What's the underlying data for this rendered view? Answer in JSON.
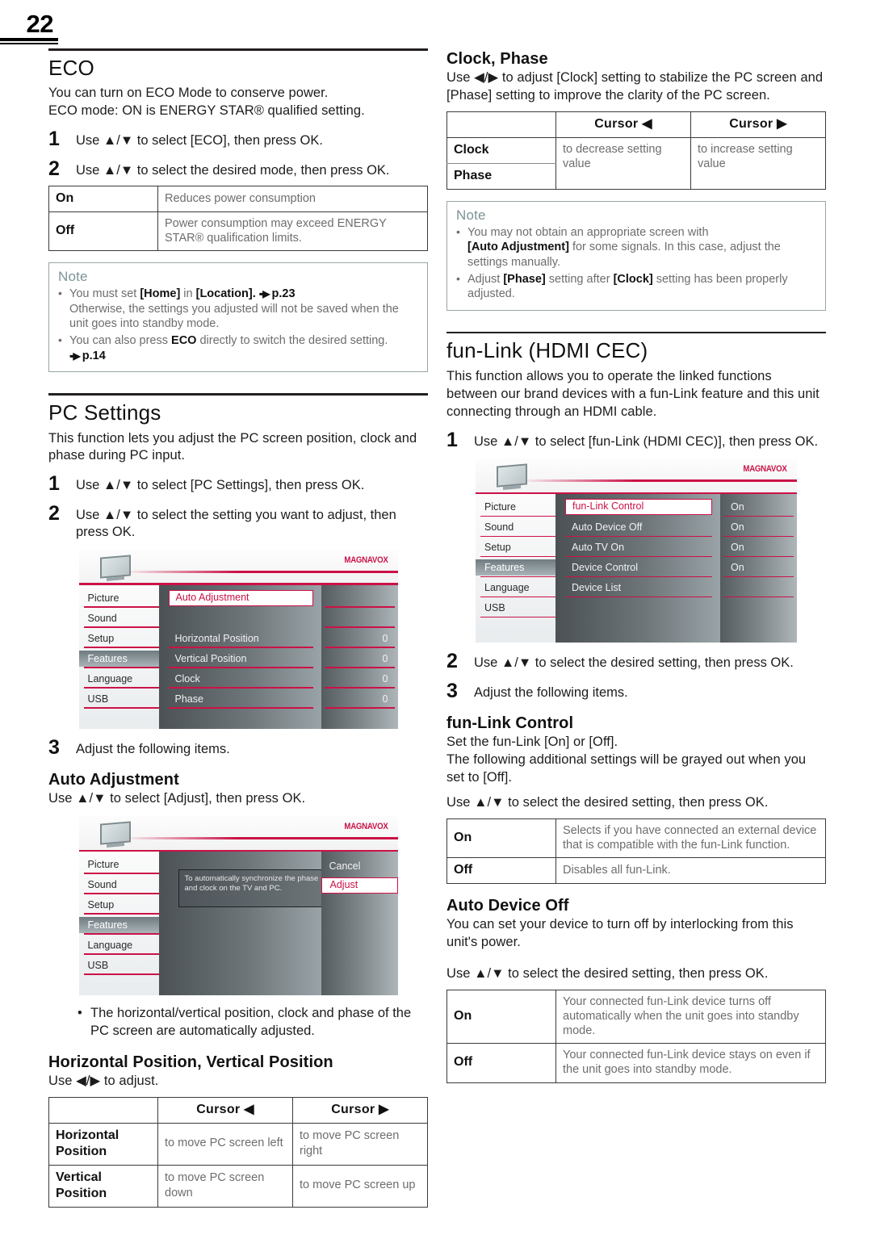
{
  "page": {
    "number": "22"
  },
  "left": {
    "eco": {
      "title": "ECO",
      "intro_line1": "You can turn on ECO Mode to conserve power.",
      "intro_line2": "ECO mode: ON is ENERGY STAR® qualified setting.",
      "step1": "Use ▲/▼ to select [ECO], then press OK.",
      "step1_num": "1",
      "step2": "Use ▲/▼ to select the desired mode, then press OK.",
      "step2_num": "2",
      "table": {
        "rows": [
          {
            "key": "On",
            "desc": "Reduces power consumption"
          },
          {
            "key": "Off",
            "desc": "Power consumption may exceed ENERGY STAR® qualification limits."
          }
        ]
      },
      "note": {
        "title": "Note",
        "item1_a": "You must set ",
        "item1_b": "[Home]",
        "item1_c": " in ",
        "item1_d": "[Location].",
        "item1_ref": "p.23",
        "item1_cont": "Otherwise, the settings you adjusted will not be saved when the unit goes into standby mode.",
        "item2_a": "You can also press ",
        "item2_b": "ECO",
        "item2_c": " directly to switch the desired setting.",
        "item2_ref": "p.14"
      }
    },
    "pc_settings": {
      "title": "PC Settings",
      "intro": "This function lets you adjust the PC screen position, clock and phase during PC input.",
      "step1_num": "1",
      "step1": "Use ▲/▼ to select [PC Settings], then press OK.",
      "step2_num": "2",
      "step2": "Use ▲/▼ to select the setting you want to adjust, then press OK.",
      "step3_num": "3",
      "step3": "Adjust the following items.",
      "osd1": {
        "brand": "MAGNAVOX",
        "sidebar": [
          "Picture",
          "Sound",
          "Setup",
          "Features",
          "Language",
          "USB"
        ],
        "selected_sidebar": "Features",
        "rows": [
          "Auto Adjustment",
          "",
          "Horizontal Position",
          "Vertical Position",
          "Clock",
          "Phase"
        ],
        "highlighted_row": "Auto Adjustment",
        "values": [
          "",
          "",
          "0",
          "0",
          "0",
          "0"
        ]
      },
      "auto_adjustment": {
        "title": "Auto Adjustment",
        "desc": "Use ▲/▼ to select [Adjust], then press OK.",
        "osd2": {
          "brand": "MAGNAVOX",
          "sidebar": [
            "Picture",
            "Sound",
            "Setup",
            "Features",
            "Language",
            "USB"
          ],
          "selected_sidebar": "Features",
          "message": "To automatically synchronize the phase and clock on the TV and PC.",
          "choices": [
            "Cancel",
            "Adjust"
          ],
          "highlighted_choice": "Adjust"
        },
        "bullet": "The horizontal/vertical position, clock and phase of the PC screen are automatically adjusted."
      },
      "hv_position": {
        "title": "Horizontal Position, Vertical Position",
        "desc": "Use ◀/▶ to adjust.",
        "headers": [
          "",
          "Cursor ◀",
          "Cursor ▶"
        ],
        "rows": [
          {
            "key": "Horizontal Position",
            "left": "to move PC screen left",
            "right": "to move PC screen right"
          },
          {
            "key": "Vertical Position",
            "left": "to move PC screen down",
            "right": "to move PC screen up"
          }
        ]
      }
    }
  },
  "right": {
    "clock_phase": {
      "title": "Clock, Phase",
      "desc": "Use ◀/▶ to adjust [Clock] setting to stabilize the PC screen and [Phase] setting to improve the clarity of the PC screen.",
      "headers": [
        "",
        "Cursor ◀",
        "Cursor ▶"
      ],
      "rows": [
        {
          "key": "Clock"
        },
        {
          "key": "Phase"
        }
      ],
      "merged_left": "to decrease setting value",
      "merged_right": "to increase setting value",
      "note": {
        "title": "Note",
        "item1_a": "You may not obtain an appropriate screen with ",
        "item1_b": "[Auto Adjustment]",
        "item1_c": " for some signals. In this case, adjust the settings manually.",
        "item2_a": "Adjust ",
        "item2_b": "[Phase]",
        "item2_c": " setting after ",
        "item2_d": "[Clock]",
        "item2_e": " setting has been properly adjusted."
      }
    },
    "funlink": {
      "title": "fun-Link (HDMI CEC)",
      "intro": "This function allows you to operate the linked functions between our brand devices with a fun-Link feature and this unit connecting through an HDMI cable.",
      "step1_num": "1",
      "step1": "Use ▲/▼ to select [fun-Link (HDMI CEC)], then press OK.",
      "osd3": {
        "brand": "MAGNAVOX",
        "sidebar": [
          "Picture",
          "Sound",
          "Setup",
          "Features",
          "Language",
          "USB"
        ],
        "selected_sidebar": "Features",
        "rows": [
          "fun-Link Control",
          "Auto Device Off",
          "Auto TV On",
          "Device Control",
          "Device List"
        ],
        "highlighted_row": "fun-Link Control",
        "values": [
          "On",
          "On",
          "On",
          "On",
          ""
        ]
      },
      "step2_num": "2",
      "step2": "Use ▲/▼ to select the desired setting, then press OK.",
      "step3_num": "3",
      "step3": "Adjust the following items.",
      "control": {
        "title": "fun-Link Control",
        "line1": "Set the fun-Link [On] or [Off].",
        "line2": "The following additional settings will be grayed out when you set to [Off].",
        "use_line": "Use ▲/▼ to select the desired setting, then press OK.",
        "table": {
          "rows": [
            {
              "key": "On",
              "desc": "Selects if you have connected an external device that is compatible with the fun-Link function."
            },
            {
              "key": "Off",
              "desc": "Disables all fun-Link."
            }
          ]
        }
      },
      "auto_device_off": {
        "title": "Auto Device Off",
        "desc": "You can set your device to turn off by interlocking from this unit's power.",
        "use_line": "Use ▲/▼ to select the desired setting, then press OK.",
        "table": {
          "rows": [
            {
              "key": "On",
              "desc": "Your connected fun-Link device turns off automatically when the unit goes into standby mode."
            },
            {
              "key": "Off",
              "desc": "Your connected fun-Link device stays on even if the unit goes into standby mode."
            }
          ]
        }
      }
    }
  },
  "colors": {
    "accent_red": "#cb1246",
    "note_title": "#7e9397",
    "table_text": "#6d6d6d"
  }
}
